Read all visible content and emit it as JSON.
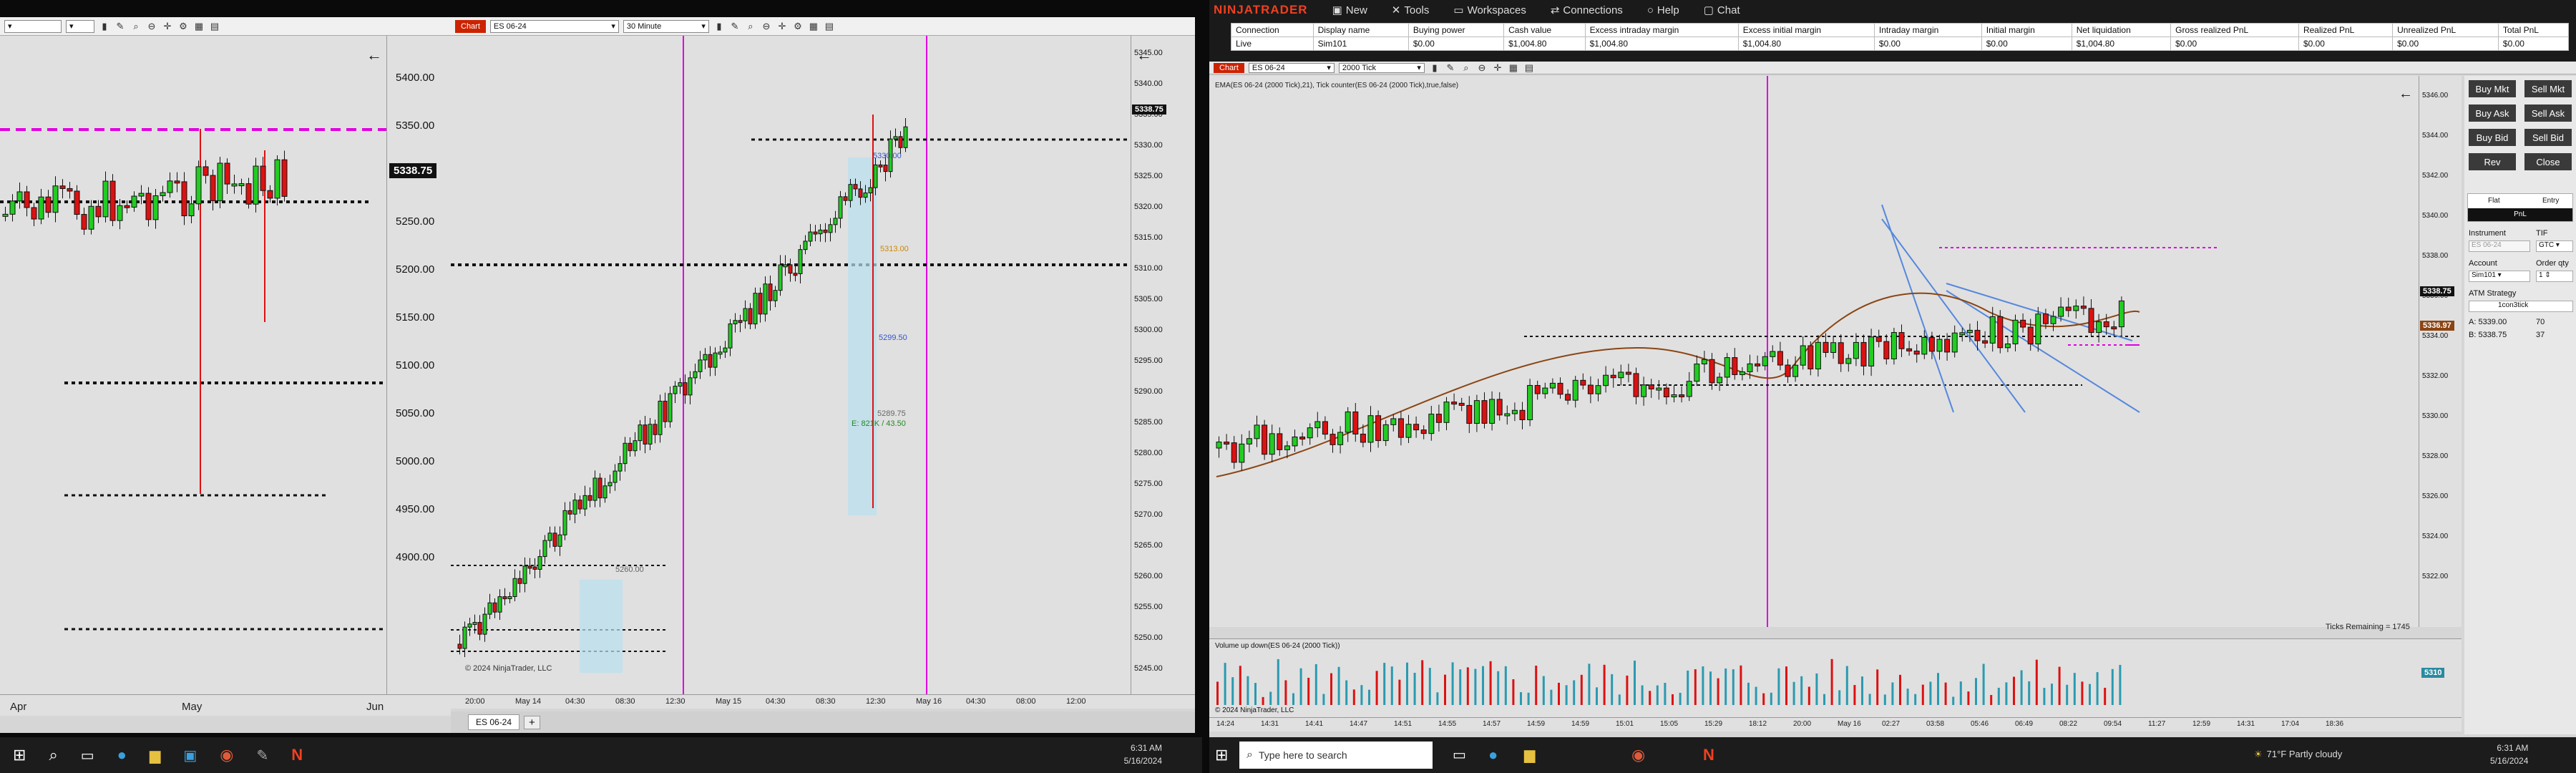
{
  "left_window": {
    "x_labels": [
      "Apr",
      "May",
      "Jun"
    ],
    "price_labels": [
      "5400.00",
      "5350.00",
      "5300.00",
      "5250.00",
      "5200.00",
      "5150.00",
      "5100.00",
      "5050.00",
      "5000.00",
      "4950.00",
      "4900.00"
    ],
    "current_price": "5338.75",
    "accent_color": "#e000e0"
  },
  "mid_window": {
    "tab_label": "Chart",
    "instrument": "ES 06-24",
    "interval": "30 Minute",
    "price_labels": [
      "5345.00",
      "5340.00",
      "5335.00",
      "5330.00",
      "5325.00",
      "5320.00",
      "5315.00",
      "5310.00",
      "5305.00",
      "5300.00",
      "5295.00",
      "5290.00",
      "5285.00",
      "5280.00",
      "5275.00",
      "5270.00",
      "5265.00",
      "5260.00",
      "5255.00",
      "5250.00",
      "5245.00"
    ],
    "current_price": "5338.75",
    "x_labels": [
      "20:00",
      "May 14",
      "04:30",
      "08:30",
      "12:30",
      "May 15",
      "04:30",
      "08:30",
      "12:30",
      "May 16",
      "04:30",
      "08:00",
      "12:00"
    ],
    "annotations": [
      "5330.00",
      "5313.00",
      "5299.50",
      "5289.75",
      "E: 821K / 43.50",
      "5260.00"
    ],
    "copyright": "© 2024 NinjaTrader, LLC",
    "bottom_tab": "ES 06-24",
    "add_tab": "+"
  },
  "taskbar_left": {
    "time": "6:31 AM",
    "date": "5/16/2024"
  },
  "control_center": {
    "brand": "NINJATRADER",
    "menu": [
      "New",
      "Tools",
      "Workspaces",
      "Connections",
      "Help",
      "Chat"
    ],
    "columns": [
      "Connection",
      "Display name",
      "Buying power",
      "Cash value",
      "Excess intraday margin",
      "Excess initial margin",
      "Intraday margin",
      "Initial margin",
      "Net liquidation",
      "Gross realized PnL",
      "Realized PnL",
      "Unrealized PnL",
      "Total PnL"
    ],
    "row": [
      "Live",
      "Sim101",
      "$0.00",
      "$1,004.80",
      "$1,004.80",
      "$1,004.80",
      "$0.00",
      "$0.00",
      "$1,004.80",
      "$0.00",
      "$0.00",
      "$0.00",
      "$0.00"
    ]
  },
  "right_chart": {
    "tab_label": "Chart",
    "instrument": "ES 06-24",
    "interval": "2000 Tick",
    "indicator_label": "EMA(ES 06-24 (2000 Tick),21), Tick counter(ES 06-24 (2000 Tick),true,false)",
    "price_labels": [
      "5346.00",
      "5344.00",
      "5342.00",
      "5340.00",
      "5338.00",
      "5336.00",
      "5334.00",
      "5332.00",
      "5330.00",
      "5328.00",
      "5326.00",
      "5324.00",
      "5322.00"
    ],
    "current_price": "5338.75",
    "ema_price": "5336.97",
    "ticks_remaining": "Ticks Remaining = 1745",
    "volume_label": "Volume up down(ES 06-24 (2000 Tick))",
    "volume_badge": "5310",
    "copyright": "© 2024 NinjaTrader, LLC",
    "x_labels": [
      "14:24",
      "14:31",
      "14:41",
      "14:47",
      "14:51",
      "14:55",
      "14:57",
      "14:59",
      "14:59",
      "15:01",
      "15:05",
      "15:29",
      "18:12",
      "20:00",
      "May 16",
      "02:27",
      "03:58",
      "05:46",
      "06:49",
      "08:22",
      "09:54",
      "11:27",
      "12:59",
      "14:31",
      "17:04",
      "18:36"
    ]
  },
  "order_panel": {
    "buttons": [
      "Buy Mkt",
      "Sell Mkt",
      "Buy Ask",
      "Sell Ask",
      "Buy Bid",
      "Sell Bid",
      "Rev",
      "Close"
    ],
    "flat": "Flat",
    "entry": "Entry",
    "pnl": "PnL",
    "instrument_label": "Instrument",
    "tif_label": "TIF",
    "instrument_value": "ES 06-24",
    "tif_value": "GTC",
    "account_label": "Account",
    "order_qty_label": "Order qty",
    "account_value": "Sim101",
    "qty_value": "1",
    "atm_label": "ATM Strategy",
    "atm_value": "1con3tick",
    "ask": "A: 5339.00",
    "ask_size": "70",
    "bid": "B: 5338.75",
    "bid_size": "37"
  },
  "taskbar_right": {
    "search_placeholder": "Type here to search",
    "weather": "71°F  Partly cloudy",
    "time": "6:31 AM",
    "date": "5/16/2024"
  }
}
